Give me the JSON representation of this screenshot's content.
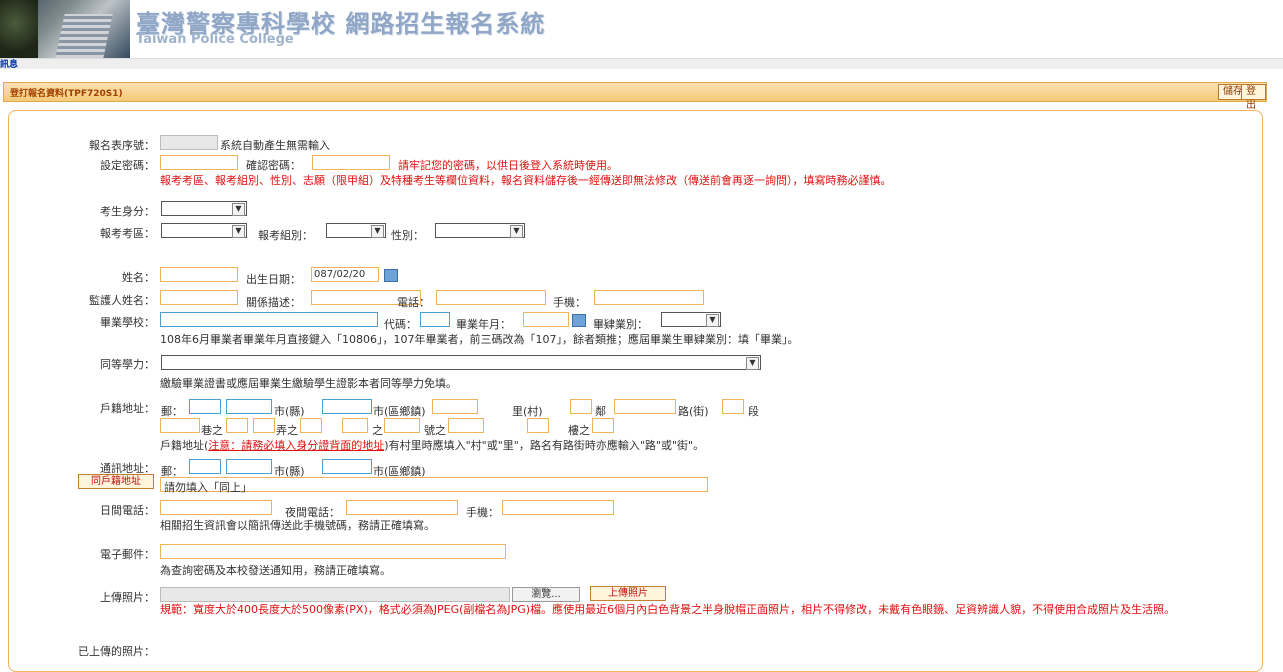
{
  "header": {
    "title_zh": "臺灣警察專科學校 網路招生報名系統",
    "title_en": "Taiwan Police College",
    "msg_link": "訊息"
  },
  "titlebar": {
    "title": "登打報名資料(TPF720S1)",
    "save_label": "儲存",
    "logout_label": "登出"
  },
  "form": {
    "serial_label": "報名表序號：",
    "serial_note": "系統自動產生無需輸入",
    "pwd_label": "設定密碼：",
    "pwd_confirm_label": "確認密碼：",
    "pwd_note": "請牢記您的密碼，以供日後登入系統時使用。",
    "warn": "報考考區、報考組別、性別、志願（限甲組）及特種考生等欄位資料，報名資料儲存後一經傳送即無法修改（傳送前會再逐一詢問），填寫時務必謹慎。",
    "identity_label": "考生身分：",
    "area_label": "報考考區：",
    "group_label": "報考組別：",
    "gender_label": "性別：",
    "name_label": "姓名：",
    "birth_label": "出生日期：",
    "birth_value": "087/02/20",
    "guardian_label": "監護人姓名：",
    "relation_label": "關係描述：",
    "phone_label": "電話：",
    "mobile_label": "手機：",
    "school_label": "畢業學校：",
    "code_label": "代碼：",
    "grad_ym_label": "畢業年月：",
    "grad_type_label": "畢肄業別：",
    "school_note": "108年6月畢業者畢業年月直接鍵入「10806」，107年畢業者，前三碼改為「107」，餘者類推；應屆畢業生畢肄業別：填「畢業」。",
    "equiv_label": "同等學力：",
    "equiv_note": "繳驗畢業證書或應屆畢業生繳驗學生證影本者同等學力免填。",
    "reg_addr_label": "戶籍地址：",
    "zip_label": "郵：",
    "county_label": "市(縣)",
    "town_label": "市(區鄉鎮)",
    "village_label": "里(村)",
    "lin_label": "鄰",
    "road_label": "路(街)",
    "sec_label": "段",
    "lane_label": "巷之",
    "alley_label": "弄之",
    "zhi_label": "之",
    "no_label": "號之",
    "floor_label": "樓之",
    "addr_note_a": "戶籍地址(",
    "addr_note_link": "注意：請務必填入身分證背面的地址",
    "addr_note_b": ")有村里時應填入\"村\"或\"里\"，路名有路街時亦應輸入\"路\"或\"街\"。",
    "mail_addr_label": "通訊地址：",
    "same_btn": "同戶籍地址",
    "same_note": "請勿填入「同上」",
    "day_phone_label": "日間電話：",
    "night_phone_label": "夜間電話：",
    "mobile2_label": "手機：",
    "phone_note": "相關招生資訊會以簡訊傳送此手機號碼，務請正確填寫。",
    "email_label": "電子郵件：",
    "email_note": "為查詢密碼及本校發送通知用，務請正確填寫。",
    "photo_label": "上傳照片：",
    "browse_btn": "瀏覽...",
    "upload_btn": "上傳照片",
    "photo_note": "規範：寬度大於400長度大於500像素(PX)，格式必須為JPEG(副檔名為JPG)檔。應使用最近6個月內白色背景之半身脫帽正面照片，相片不得修改，未戴有色眼鏡、足資辨識人貌，不得使用合成照片及生活照。",
    "uploaded_label": "已上傳的照片："
  }
}
